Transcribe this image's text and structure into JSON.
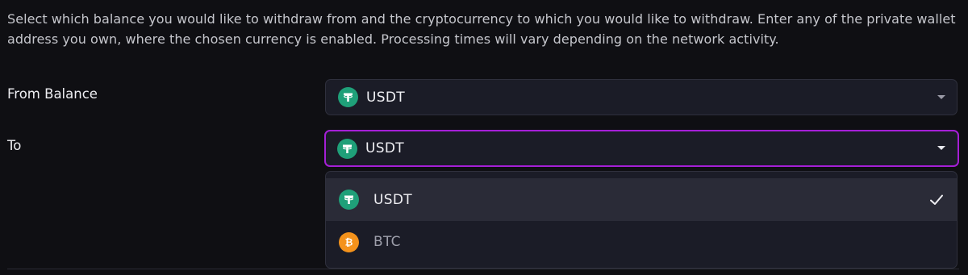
{
  "intro": {
    "line1": "Select which balance you would like to withdraw from and the cryptocurrency to which you would like to withdraw. Enter any of the private wallet",
    "line2": "address you own, where the chosen currency is enabled. Processing times will vary depending on the network activity."
  },
  "from_balance": {
    "label": "From Balance",
    "selected": "USDT",
    "icon": "tether-icon"
  },
  "to": {
    "label": "To",
    "selected": "USDT",
    "icon": "tether-icon",
    "options": [
      {
        "label": "USDT",
        "icon": "tether-icon",
        "selected": true
      },
      {
        "label": "BTC",
        "icon": "bitcoin-icon",
        "selected": false
      }
    ]
  },
  "colors": {
    "background": "#0f0f13",
    "field": "#1b1c27",
    "focus_border": "#a51fd6",
    "usdt": "#1fa079",
    "btc": "#f4921b"
  }
}
